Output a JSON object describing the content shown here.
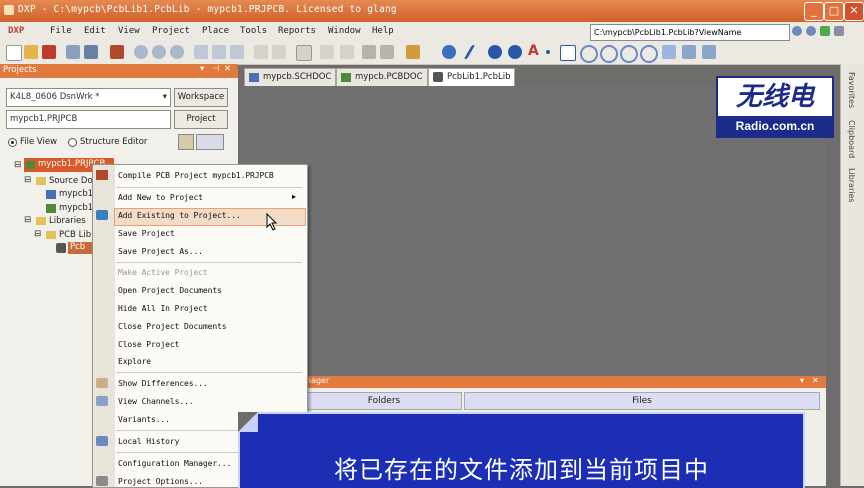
{
  "window": {
    "title": "DXP - C:\\mypcb\\PcbLib1.PcbLib - mypcb1.PRJPCB. Licensed to glang"
  },
  "menubar": {
    "items": [
      "DXP",
      "File",
      "Edit",
      "View",
      "Project",
      "Place",
      "Tools",
      "Reports",
      "Window",
      "Help"
    ]
  },
  "path_box": {
    "value": "C:\\mypcb\\PcbLib1.PcbLib?ViewName"
  },
  "projects_panel": {
    "title": "Projects",
    "workspace_combo": "K4L8_0606 DsnWrk *",
    "workspace_button": "Workspace",
    "project_combo": "mypcb1.PRJPCB",
    "project_button": "Project",
    "radio_file_view": "File View",
    "radio_structure_editor": "Structure Editor",
    "tree": {
      "project": "mypcb1.PRJPCB",
      "source_docs": "Source Do",
      "doc1": "mypcb1",
      "doc2": "mypcb1",
      "libraries": "Libraries",
      "pcb_lib": "PCB Lib",
      "lib_item": "Pcb"
    }
  },
  "tabs": [
    {
      "label": "mypcb.SCHDOC"
    },
    {
      "label": "mypcb.PCBDOC"
    },
    {
      "label": "PcbLib1.PcbLib"
    }
  ],
  "context_menu": {
    "items": [
      {
        "label": "Compile PCB Project mypcb1.PRJPCB",
        "disabled": false
      },
      {
        "label": "Add New to Project",
        "disabled": false,
        "submenu": true
      },
      {
        "label": "Add Existing to Project...",
        "disabled": false,
        "highlighted": true
      },
      {
        "label": "Save Project",
        "disabled": false
      },
      {
        "label": "Save Project As...",
        "disabled": false
      },
      {
        "label": "Make Active Project",
        "disabled": true
      },
      {
        "label": "Open Project Documents",
        "disabled": false
      },
      {
        "label": "Hide All In Project",
        "disabled": false
      },
      {
        "label": "Close Project Documents",
        "disabled": false
      },
      {
        "label": "Close Project",
        "disabled": false
      },
      {
        "label": "Explore",
        "disabled": false
      },
      {
        "label": "Show Differences...",
        "disabled": false
      },
      {
        "label": "View Channels...",
        "disabled": false
      },
      {
        "label": "Variants...",
        "disabled": false
      },
      {
        "label": "Local History",
        "disabled": false
      },
      {
        "label": "Configuration Manager...",
        "disabled": false
      },
      {
        "label": "Project Options...",
        "disabled": false
      }
    ]
  },
  "storage_panel": {
    "title_fragment": "nager",
    "col_folders": "Folders",
    "col_files": "Files"
  },
  "right_sidebar": {
    "tabs": [
      "Favorites",
      "Clipboard",
      "Libraries"
    ]
  },
  "logo": {
    "chinese": "无线电",
    "url": "Radio.com.cn"
  },
  "banner": {
    "text": "将已存在的文件添加到当前项目中"
  },
  "colors": {
    "title_orange": "#d96a32",
    "banner_blue": "#1c2fb4",
    "workspace_gray": "#707070",
    "highlight": "#f3dbc6"
  }
}
